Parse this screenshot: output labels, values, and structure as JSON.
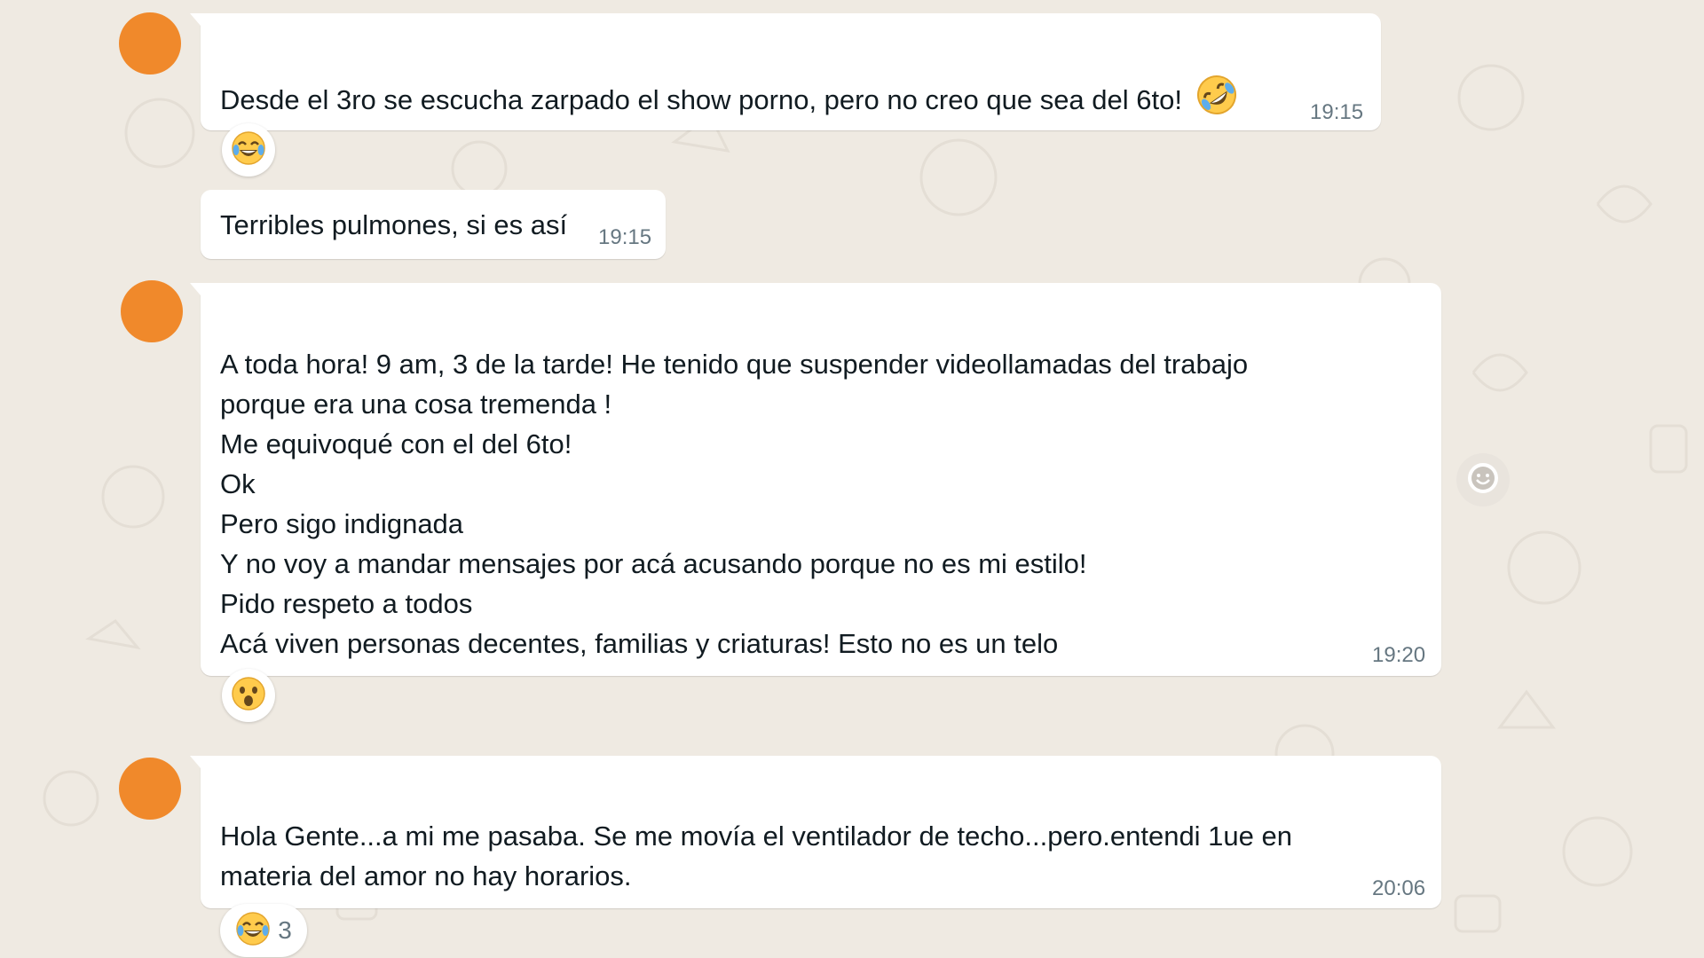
{
  "messages": [
    {
      "lines": [
        "Desde el 3ro se escucha zarpado el show porno, pero no creo que sea del 6to!"
      ],
      "time": "19:15",
      "emoji": "rofl",
      "reaction": {
        "emoji": "joy",
        "count": ""
      }
    },
    {
      "lines": [
        "Terribles pulmones, si es así"
      ],
      "time": "19:15"
    },
    {
      "lines": [
        "A toda hora! 9 am, 3 de la tarde! He tenido que suspender videollamadas del trabajo",
        "porque era una cosa tremenda !",
        "Me equivoqué con el del 6to!",
        "Ok",
        "Pero sigo indignada",
        "Y no voy a mandar mensajes por acá acusando porque no es mi estilo!",
        "Pido respeto a todos",
        "Acá viven personas decentes, familias y criaturas! Esto no es un telo"
      ],
      "time": "19:20",
      "reaction": {
        "emoji": "astonished",
        "count": ""
      }
    },
    {
      "lines": [
        "Hola Gente...a mi me pasaba. Se me movía el ventilador de techo...pero.entendi 1ue en",
        "materia del amor no hay horarios."
      ],
      "time": "20:06",
      "reaction": {
        "emoji": "joy",
        "count": "3"
      }
    }
  ],
  "icons": {
    "avatar": "avatar",
    "react_button": "smiley-icon"
  },
  "colors": {
    "background": "#efeae2",
    "bubble": "#ffffff",
    "avatar": "#f0892b",
    "text": "#111b21",
    "time": "#667781"
  }
}
